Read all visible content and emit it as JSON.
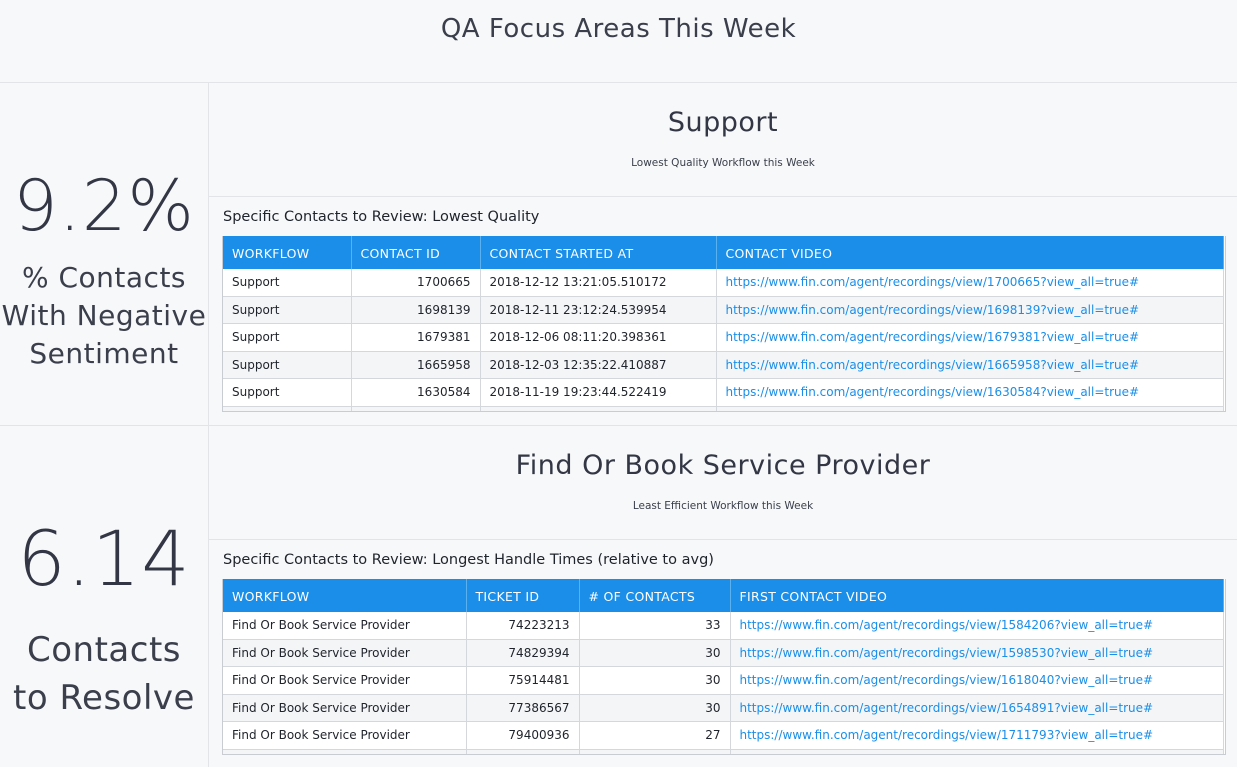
{
  "title": "QA Focus Areas This Week",
  "colors": {
    "header_blue": "#1a8ee8",
    "link_blue": "#1a8ee8",
    "text_dark": "#333745"
  },
  "sections": [
    {
      "stat": {
        "value": "9.2%",
        "label_lines": [
          "% Contacts",
          "With Negative",
          "Sentiment"
        ]
      },
      "workflow": {
        "name": "Support",
        "subtitle": "Lowest Quality Workflow this Week"
      },
      "table": {
        "title": "Specific Contacts to Review: Lowest Quality",
        "columns": [
          "WORKFLOW",
          "CONTACT ID",
          "CONTACT STARTED AT",
          "CONTACT VIDEO"
        ],
        "rows": [
          [
            "Support",
            "1700665",
            "2018-12-12 13:21:05.510172",
            "https://www.fin.com/agent/recordings/view/1700665?view_all=true#"
          ],
          [
            "Support",
            "1698139",
            "2018-12-11 23:12:24.539954",
            "https://www.fin.com/agent/recordings/view/1698139?view_all=true#"
          ],
          [
            "Support",
            "1679381",
            "2018-12-06 08:11:20.398361",
            "https://www.fin.com/agent/recordings/view/1679381?view_all=true#"
          ],
          [
            "Support",
            "1665958",
            "2018-12-03 12:35:22.410887",
            "https://www.fin.com/agent/recordings/view/1665958?view_all=true#"
          ],
          [
            "Support",
            "1630584",
            "2018-11-19 19:23:44.522419",
            "https://www.fin.com/agent/recordings/view/1630584?view_all=true#"
          ]
        ]
      }
    },
    {
      "stat": {
        "value": "6.14",
        "label_lines": [
          "Contacts",
          "to Resolve"
        ]
      },
      "workflow": {
        "name": "Find Or Book Service Provider",
        "subtitle": "Least Efficient Workflow this Week"
      },
      "table": {
        "title": "Specific Contacts to Review: Longest Handle Times (relative to avg)",
        "columns": [
          "WORKFLOW",
          "TICKET ID",
          "# OF CONTACTS",
          "FIRST CONTACT VIDEO"
        ],
        "rows": [
          [
            "Find Or Book Service Provider",
            "74223213",
            "33",
            "https://www.fin.com/agent/recordings/view/1584206?view_all=true#"
          ],
          [
            "Find Or Book Service Provider",
            "74829394",
            "30",
            "https://www.fin.com/agent/recordings/view/1598530?view_all=true#"
          ],
          [
            "Find Or Book Service Provider",
            "75914481",
            "30",
            "https://www.fin.com/agent/recordings/view/1618040?view_all=true#"
          ],
          [
            "Find Or Book Service Provider",
            "77386567",
            "30",
            "https://www.fin.com/agent/recordings/view/1654891?view_all=true#"
          ],
          [
            "Find Or Book Service Provider",
            "79400936",
            "27",
            "https://www.fin.com/agent/recordings/view/1711793?view_all=true#"
          ]
        ]
      }
    }
  ]
}
